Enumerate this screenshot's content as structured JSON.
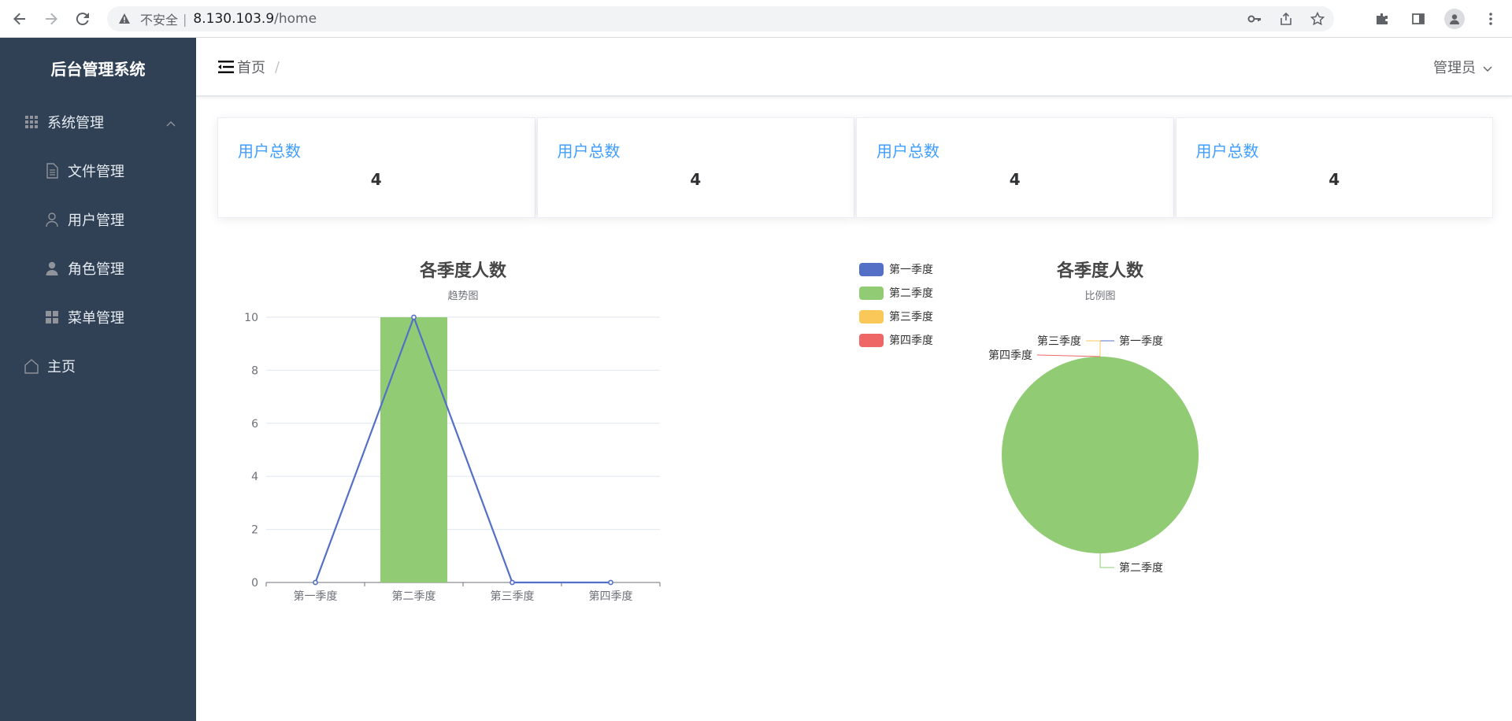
{
  "browser": {
    "insecure_label": "不安全",
    "url_host": "8.130.103.9",
    "url_path": "/home"
  },
  "sidebar": {
    "title": "后台管理系统",
    "items": [
      {
        "label": "系统管理",
        "icon": "grid-icon",
        "expanded": true
      },
      {
        "label": "文件管理",
        "icon": "document-icon"
      },
      {
        "label": "用户管理",
        "icon": "user-icon"
      },
      {
        "label": "角色管理",
        "icon": "person-filled-icon"
      },
      {
        "label": "菜单管理",
        "icon": "menu-grid-icon"
      },
      {
        "label": "主页",
        "icon": "home-icon"
      }
    ],
    "background": "#304156"
  },
  "header": {
    "breadcrumb": "首页",
    "breadcrumb_sep": "/",
    "user": "管理员"
  },
  "cards": [
    {
      "title": "用户总数",
      "value": "4"
    },
    {
      "title": "用户总数",
      "value": "4"
    },
    {
      "title": "用户总数",
      "value": "4"
    },
    {
      "title": "用户总数",
      "value": "4"
    }
  ],
  "chart_data": [
    {
      "type": "bar",
      "title": "各季度人数",
      "subtitle": "趋势图",
      "categories": [
        "第一季度",
        "第二季度",
        "第三季度",
        "第四季度"
      ],
      "ylim": [
        0,
        10
      ],
      "yticks": [
        "0",
        "2",
        "4",
        "6",
        "8",
        "10"
      ],
      "series": [
        {
          "type": "bar",
          "values": [
            0,
            10,
            0,
            0
          ],
          "color": "#91cc75"
        },
        {
          "type": "line",
          "values": [
            0,
            10,
            0,
            0
          ],
          "color": "#5470c6"
        }
      ],
      "grid": true
    },
    {
      "type": "pie",
      "title": "各季度人数",
      "subtitle": "比例图",
      "legend_position": "top-left",
      "slices": [
        {
          "name": "第一季度",
          "value": 0,
          "color": "#5470c6"
        },
        {
          "name": "第二季度",
          "value": 10,
          "color": "#91cc75"
        },
        {
          "name": "第三季度",
          "value": 0,
          "color": "#fac858"
        },
        {
          "name": "第四季度",
          "value": 0,
          "color": "#ee6666"
        }
      ]
    }
  ]
}
